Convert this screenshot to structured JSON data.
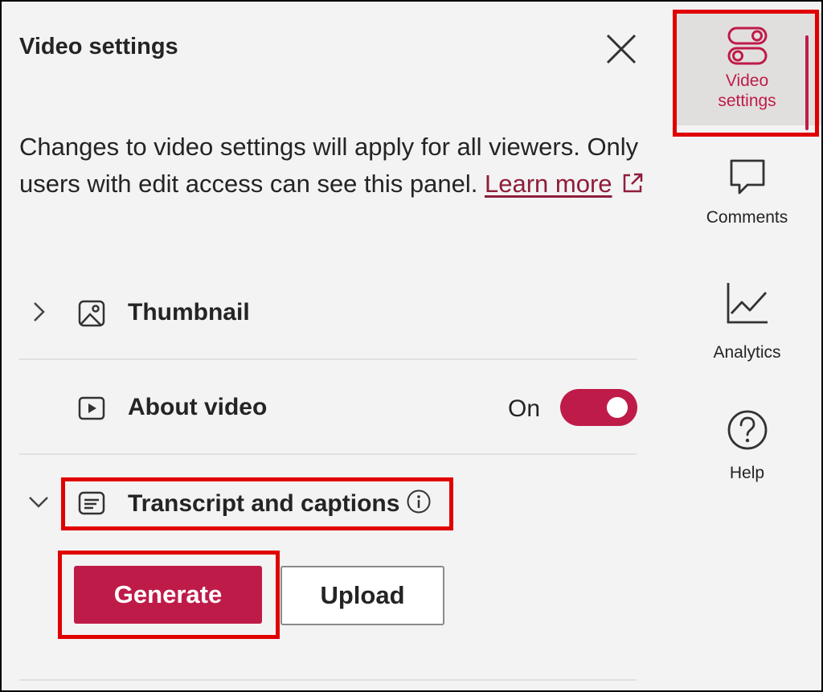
{
  "panel": {
    "title": "Video settings",
    "description": "Changes to video settings will apply for all viewers. Only users with edit access can see this panel.",
    "learn_more": "Learn more"
  },
  "sections": {
    "thumbnail": {
      "label": "Thumbnail",
      "icon": "image-icon",
      "expanded": false
    },
    "about_video": {
      "label": "About video",
      "icon": "play-icon",
      "toggle_text": "On",
      "toggle_on": true
    },
    "transcript": {
      "label": "Transcript and captions",
      "icon": "captions-icon",
      "expanded": true
    }
  },
  "buttons": {
    "generate": "Generate",
    "upload": "Upload"
  },
  "rail": {
    "items": [
      {
        "label_line1": "Video",
        "label_line2": "settings",
        "icon": "toggle-settings-icon",
        "active": true
      },
      {
        "label": "Comments",
        "icon": "comment-icon"
      },
      {
        "label": "Analytics",
        "icon": "chart-icon"
      },
      {
        "label": "Help",
        "icon": "help-icon"
      }
    ]
  },
  "colors": {
    "accent": "#bf1b49",
    "highlight_box": "#e00000",
    "background": "#f3f3f3"
  }
}
